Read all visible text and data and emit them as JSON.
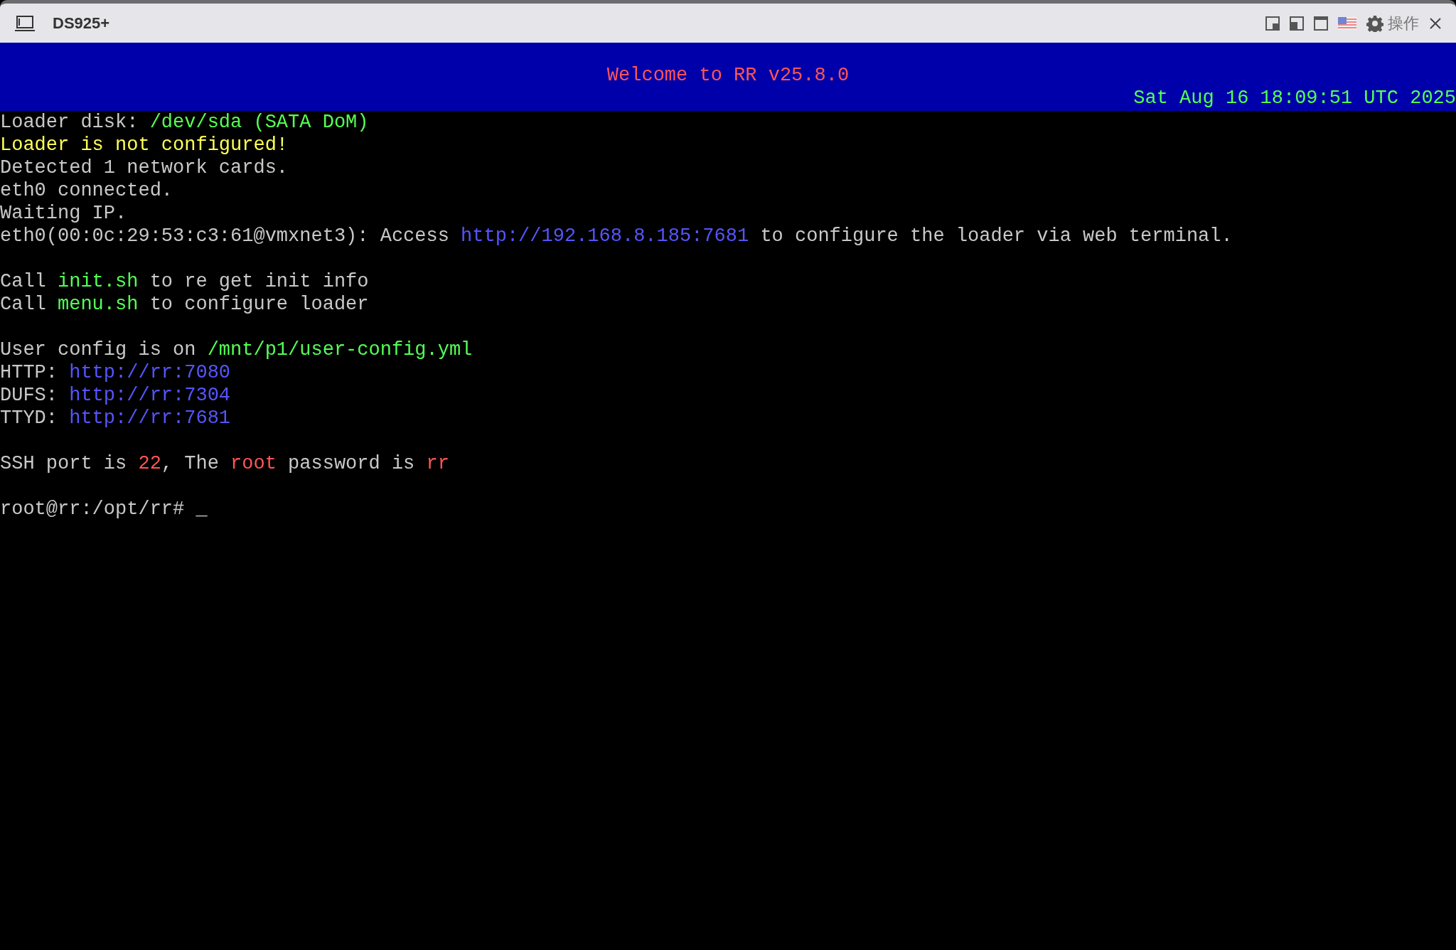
{
  "window": {
    "title": "DS925+",
    "menu_label": "操作"
  },
  "header": {
    "title": {
      "text": "Welcome to RR v25.8.0",
      "color": "#ff5555"
    },
    "clock": {
      "text": "Sat Aug 16 18:09:51 UTC 2025",
      "color": "#55ff55"
    }
  },
  "terminal": {
    "blocks": [
      [
        [
          {
            "text": "Loader disk: ",
            "color": "#c8c8c8"
          },
          {
            "text": "/dev/sda (SATA DoM)",
            "color": "#55ff55"
          }
        ],
        [
          {
            "text": "Loader is not configured!",
            "color": "#ffff55"
          }
        ],
        [
          {
            "text": "Detected 1 network cards.",
            "color": "#c8c8c8"
          }
        ],
        [
          {
            "text": "eth0 connected.",
            "color": "#c8c8c8"
          }
        ],
        [
          {
            "text": "Waiting IP.",
            "color": "#c8c8c8"
          }
        ],
        [
          {
            "text": "eth0(00:0c:29:53:c3:61@vmxnet3): Access ",
            "color": "#c8c8c8"
          },
          {
            "text": "http://192.168.8.185:7681",
            "color": "#5555ff"
          },
          {
            "text": " to configure the loader via web terminal.",
            "color": "#c8c8c8"
          }
        ]
      ],
      [
        [
          {
            "text": "Call ",
            "color": "#c8c8c8"
          },
          {
            "text": "init.sh",
            "color": "#55ff55"
          },
          {
            "text": " to re get init info",
            "color": "#c8c8c8"
          }
        ],
        [
          {
            "text": "Call ",
            "color": "#c8c8c8"
          },
          {
            "text": "menu.sh",
            "color": "#55ff55"
          },
          {
            "text": " to configure loader",
            "color": "#c8c8c8"
          }
        ]
      ],
      [
        [
          {
            "text": "User config is on ",
            "color": "#c8c8c8"
          },
          {
            "text": "/mnt/p1/user-config.yml",
            "color": "#55ff55"
          }
        ],
        [
          {
            "text": "HTTP: ",
            "color": "#c8c8c8"
          },
          {
            "text": "http://rr:7080",
            "color": "#5555ff"
          }
        ],
        [
          {
            "text": "DUFS: ",
            "color": "#c8c8c8"
          },
          {
            "text": "http://rr:7304",
            "color": "#5555ff"
          }
        ],
        [
          {
            "text": "TTYD: ",
            "color": "#c8c8c8"
          },
          {
            "text": "http://rr:7681",
            "color": "#5555ff"
          }
        ]
      ],
      [
        [
          {
            "text": "SSH port is ",
            "color": "#c8c8c8"
          },
          {
            "text": "22",
            "color": "#ff5555"
          },
          {
            "text": ", The ",
            "color": "#c8c8c8"
          },
          {
            "text": "root",
            "color": "#ff5555"
          },
          {
            "text": " password is ",
            "color": "#c8c8c8"
          },
          {
            "text": "rr",
            "color": "#ff5555"
          }
        ]
      ],
      [
        [
          {
            "text": "root@rr:/opt/rr# ",
            "color": "#c8c8c8"
          },
          {
            "text": "_",
            "color": "#c8c8c8"
          }
        ]
      ]
    ]
  }
}
